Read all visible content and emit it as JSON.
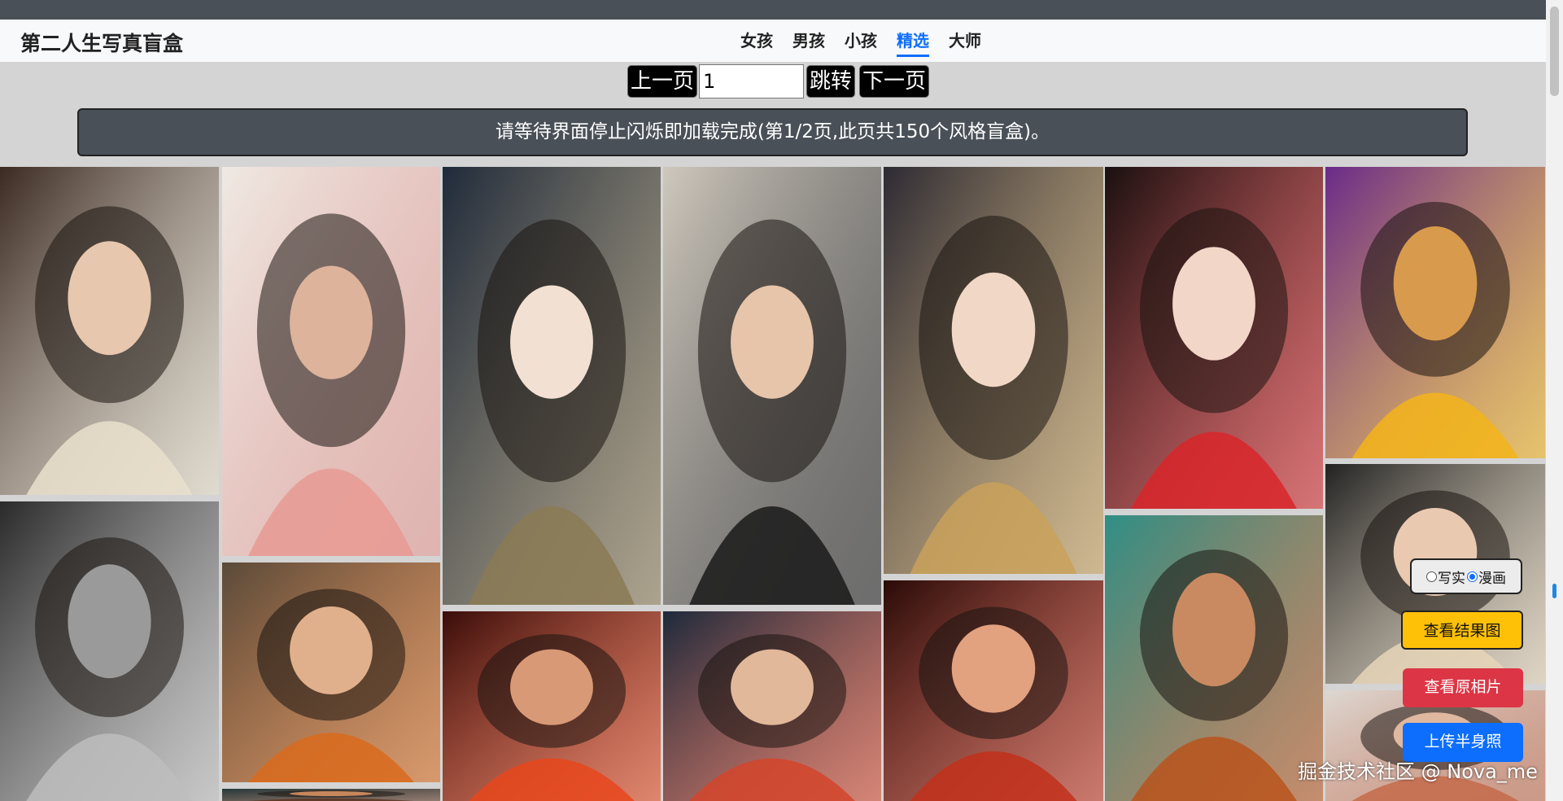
{
  "header": {
    "brand": "第二人生写真盲盒",
    "nav": [
      {
        "label": "女孩",
        "active": false
      },
      {
        "label": "男孩",
        "active": false
      },
      {
        "label": "小孩",
        "active": false
      },
      {
        "label": "精选",
        "active": true
      },
      {
        "label": "大师",
        "active": false
      }
    ]
  },
  "pager": {
    "prev_label": "上一页",
    "page_value": "1",
    "jump_label": "跳转",
    "next_label": "下一页"
  },
  "notice": "请等待界面停止闪烁即加载完成(第1/2页,此页共150个风格盲盒)。",
  "gallery": {
    "tiles": [
      {
        "name": "photo-woman-vintage-dress",
        "bg": "#3b2a22",
        "accent": "#e9e0cc",
        "skin": "#e7c7ad"
      },
      {
        "name": "photo-woman-bw-closeup",
        "bg": "#2a2a2a",
        "accent": "#bdbdbd",
        "skin": "#9a9a9a"
      },
      {
        "name": "painting-woman-pink-kimono",
        "bg": "#efe9e3",
        "accent": "#e89a93",
        "skin": "#ddb39b"
      },
      {
        "name": "photo-woman-orange-hair",
        "bg": "#5a4a3a",
        "accent": "#d96a1c",
        "skin": "#e0b08c"
      },
      {
        "name": "photo-woman-closeup-teal",
        "bg": "#24393a",
        "accent": "#5c3421",
        "skin": "#c7875c"
      },
      {
        "name": "anime-witch-give-me",
        "bg": "#1f2a3a",
        "accent": "#8b7a55",
        "skin": "#f2e0d2"
      },
      {
        "name": "photo-woman-red-neon",
        "bg": "#3a0d0a",
        "accent": "#e8461c",
        "skin": "#d89a76"
      },
      {
        "name": "painting-woman-butterfly",
        "bg": "#cfc8bd",
        "accent": "#1a1a1a",
        "skin": "#e7c5aa"
      },
      {
        "name": "photo-woman-floral-blue",
        "bg": "#1d2a3c",
        "accent": "#d4442a",
        "skin": "#e2b89a"
      },
      {
        "name": "anime-girl-crown-hat",
        "bg": "#2d2a33",
        "accent": "#c9a15a",
        "skin": "#f1d7c6"
      },
      {
        "name": "anime-woman-red-dragon",
        "bg": "#2a0b08",
        "accent": "#c2301a",
        "skin": "#e2a17f"
      },
      {
        "name": "anime-girl-red-parasol",
        "bg": "#1a1010",
        "accent": "#d8262a",
        "skin": "#f2d6c8"
      },
      {
        "name": "painting-woman-venice",
        "bg": "#2f8f86",
        "accent": "#b8541c",
        "skin": "#c98a62"
      },
      {
        "name": "poster-cowboy-horse",
        "bg": "#6a2a8a",
        "accent": "#f3b41a",
        "skin": "#d89a4c"
      },
      {
        "name": "photo-blonde-partial",
        "bg": "#222222",
        "accent": "#e6d5b8",
        "skin": "#e9c9b0"
      },
      {
        "name": "photo-tile-partial",
        "bg": "#ddd8d2",
        "accent": "#c46a4a",
        "skin": "#e0b8a0"
      }
    ]
  },
  "controls": {
    "mode_realistic": "写实",
    "mode_comic": "漫画",
    "selected_mode": "漫画",
    "view_result": "查看结果图",
    "view_original": "查看原相片",
    "upload": "上传半身照"
  },
  "watermark": "掘金技术社区 @ Nova_me",
  "colors": {
    "primary": "#0d6efd",
    "warning": "#ffc107",
    "danger": "#dc3545",
    "dark": "#495057"
  }
}
